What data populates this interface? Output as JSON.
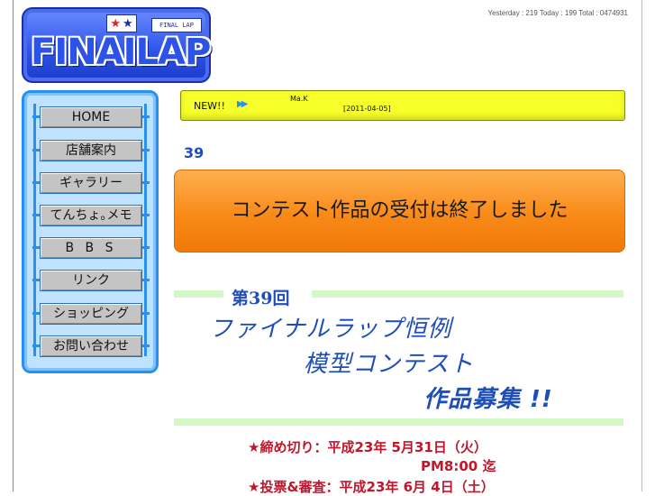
{
  "logo": {
    "wordmark": "FINAILAP",
    "stars": [
      "★",
      "★"
    ],
    "tag": "FINAL LAP",
    "colors": {
      "brand": "#2d52e8",
      "star_red": "#e0202a",
      "star_blue": "#1a2fa8"
    }
  },
  "counter": "Yesterday : 219 Today : 199 Total : 0474931",
  "sidebar": {
    "items": [
      {
        "label": "HOME"
      },
      {
        "label": "店舗案内"
      },
      {
        "label": "ギャラリー"
      },
      {
        "label": "てんちょ｡メモ"
      },
      {
        "label": "B B S"
      },
      {
        "label": "リンク"
      },
      {
        "label": "ショッピング"
      },
      {
        "label": "お問い合わせ"
      }
    ]
  },
  "news": {
    "badge": "NEW!!",
    "arrow_icon": "double-arrow-icon",
    "author": "Ma.K",
    "date": "[2011-04-05]"
  },
  "contest": {
    "number": "39",
    "closed_notice": "コンテスト作品の受付は終了しました",
    "round": "第39回",
    "title_lines": [
      "ファイナルラップ恒例",
      "模型コンテスト",
      "作品募集 !!"
    ],
    "deadline_line1": "★締め切り：平成23年 5月31日（火）",
    "deadline_line2": "PM8:00 迄",
    "judging_line": "★投票&審査：平成23年 6月 4日（土）"
  }
}
